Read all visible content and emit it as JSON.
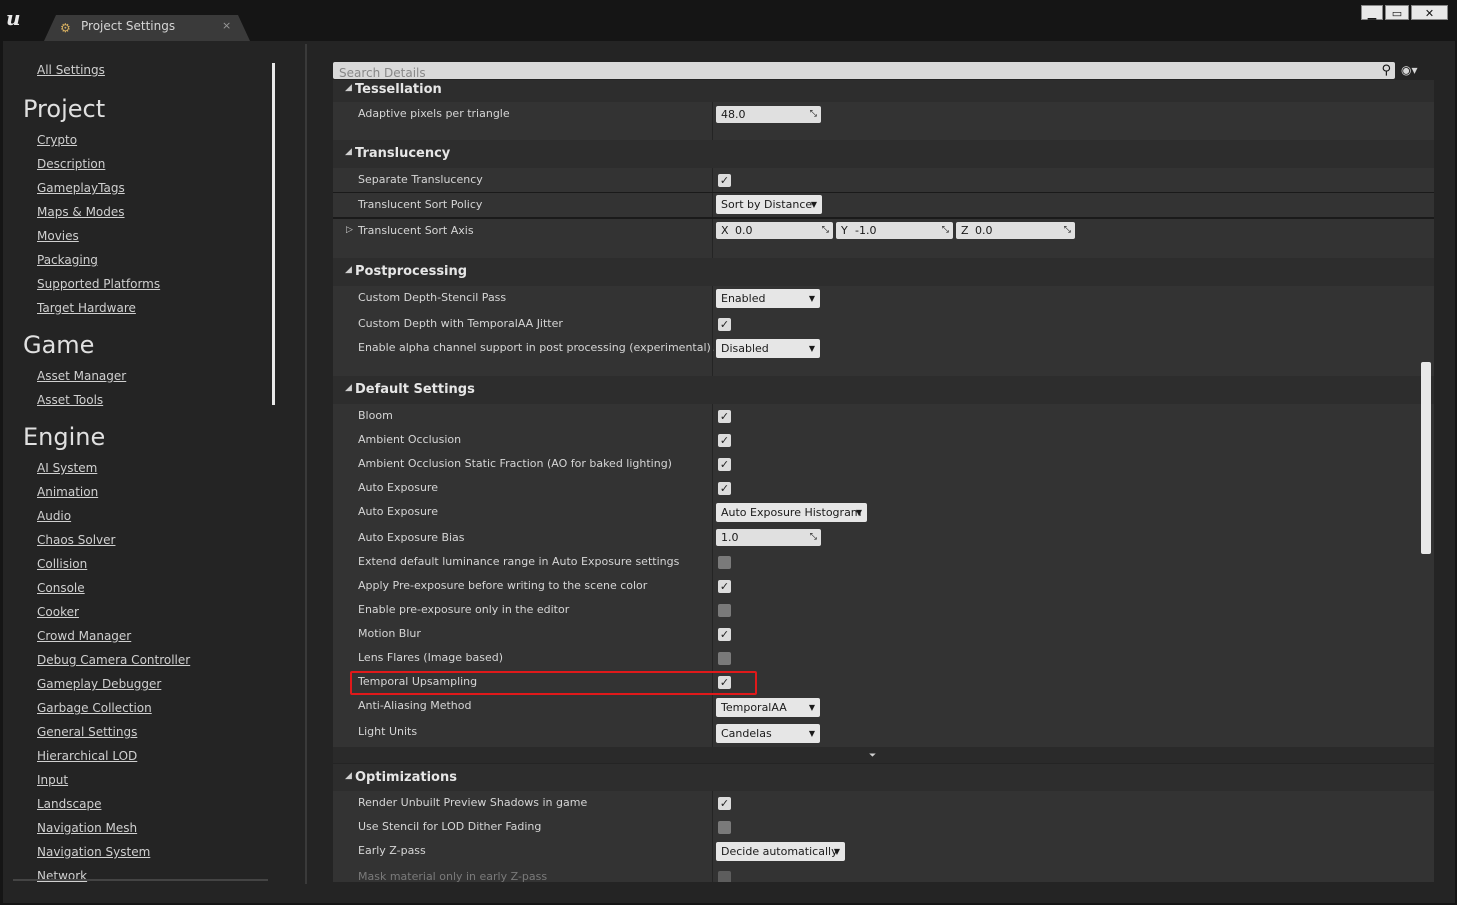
{
  "window": {
    "tab_title": "Project Settings",
    "tab_icon": "settings-gear-icon",
    "close_glyph": "×",
    "min_glyph": "▁",
    "max_glyph": "▭",
    "win_close_glyph": "✕"
  },
  "sidebar": {
    "all_settings": "All Settings",
    "sections": [
      {
        "title": "Project",
        "items": [
          "Crypto",
          "Description",
          "GameplayTags",
          "Maps & Modes",
          "Movies",
          "Packaging",
          "Supported Platforms",
          "Target Hardware"
        ]
      },
      {
        "title": "Game",
        "items": [
          "Asset Manager",
          "Asset Tools"
        ]
      },
      {
        "title": "Engine",
        "items": [
          "AI System",
          "Animation",
          "Audio",
          "Chaos Solver",
          "Collision",
          "Console",
          "Cooker",
          "Crowd Manager",
          "Debug Camera Controller",
          "Gameplay Debugger",
          "Garbage Collection",
          "General Settings",
          "Hierarchical LOD",
          "Input",
          "Landscape",
          "Navigation Mesh",
          "Navigation System",
          "Network"
        ]
      }
    ]
  },
  "search": {
    "placeholder": "Search Details"
  },
  "categories": {
    "tessellation": "Tessellation",
    "translucency": "Translucency",
    "postprocessing": "Postprocessing",
    "default_settings": "Default Settings",
    "optimizations": "Optimizations"
  },
  "rows": {
    "adaptive_pixels": {
      "label": "Adaptive pixels per triangle",
      "value": "48.0"
    },
    "separate_translucency": {
      "label": "Separate Translucency",
      "checked": true
    },
    "translucent_sort_policy": {
      "label": "Translucent Sort Policy",
      "value": "Sort by Distance"
    },
    "translucent_sort_axis": {
      "label": "Translucent Sort Axis",
      "x_label": "X",
      "x": "0.0",
      "y_label": "Y",
      "y": "-1.0",
      "z_label": "Z",
      "z": "0.0"
    },
    "custom_depth_stencil": {
      "label": "Custom Depth-Stencil Pass",
      "value": "Enabled"
    },
    "custom_depth_taa": {
      "label": "Custom Depth with TemporalAA Jitter",
      "checked": true
    },
    "alpha_channel": {
      "label": "Enable alpha channel support in post processing (experimental).",
      "value": "Disabled"
    },
    "bloom": {
      "label": "Bloom",
      "checked": true
    },
    "ambient_occlusion": {
      "label": "Ambient Occlusion",
      "checked": true
    },
    "ao_static_fraction": {
      "label": "Ambient Occlusion Static Fraction (AO for baked lighting)",
      "checked": true
    },
    "auto_exposure_chk": {
      "label": "Auto Exposure",
      "checked": true
    },
    "auto_exposure_method": {
      "label": "Auto Exposure",
      "value": "Auto Exposure Histogram"
    },
    "auto_exposure_bias": {
      "label": "Auto Exposure Bias",
      "value": "1.0"
    },
    "extend_luminance": {
      "label": "Extend default luminance range in Auto Exposure settings",
      "checked": false
    },
    "pre_exposure": {
      "label": "Apply Pre-exposure before writing to the scene color",
      "checked": true
    },
    "pre_exposure_editor": {
      "label": "Enable pre-exposure only in the editor",
      "checked": false
    },
    "motion_blur": {
      "label": "Motion Blur",
      "checked": true
    },
    "lens_flares": {
      "label": "Lens Flares (Image based)",
      "checked": false
    },
    "temporal_upsampling": {
      "label": "Temporal Upsampling",
      "checked": true
    },
    "anti_aliasing": {
      "label": "Anti-Aliasing Method",
      "value": "TemporalAA"
    },
    "light_units": {
      "label": "Light Units",
      "value": "Candelas"
    },
    "render_unbuilt": {
      "label": "Render Unbuilt Preview Shadows in game",
      "checked": true
    },
    "stencil_lod": {
      "label": "Use Stencil for LOD Dither Fading",
      "checked": false
    },
    "early_zpass": {
      "label": "Early Z-pass",
      "value": "Decide automatically"
    },
    "mask_material": {
      "label": "Mask material only in early Z-pass",
      "checked": false
    }
  },
  "glyphs": {
    "check": "✓",
    "caret": "▼",
    "collapse": "◢",
    "expand": "▷",
    "drag": "⤡",
    "advanced": "⏷"
  }
}
